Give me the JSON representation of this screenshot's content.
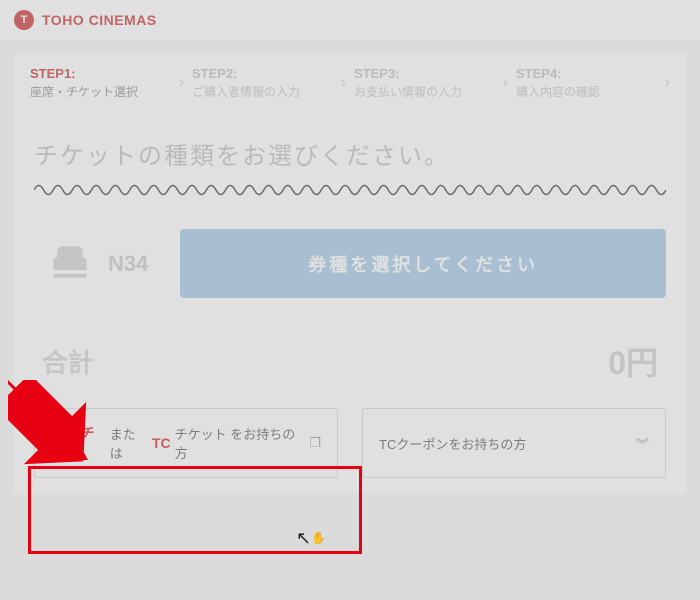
{
  "brand": {
    "name": "TOHO CINEMAS"
  },
  "steps": [
    {
      "title": "STEP1:",
      "sub": "座席・チケット選択"
    },
    {
      "title": "STEP2:",
      "sub": "ご購入者情報の入力"
    },
    {
      "title": "STEP3:",
      "sub": "お支払い情報の入力"
    },
    {
      "title": "STEP4:",
      "sub": "購入内容の確認"
    }
  ],
  "mainTitle": "チケットの種類をお選びください。",
  "seat": {
    "number": "N34",
    "selectLabel": "券種を選択してください"
  },
  "total": {
    "label": "合計",
    "value": "0円"
  },
  "promos": {
    "mvchike": {
      "brand1": "ムビチケ",
      "mid": "または",
      "brand2": "TC",
      "tail": "チケット をお持ちの方"
    },
    "coupon": {
      "label": "TCクーポンをお持ちの方"
    }
  }
}
